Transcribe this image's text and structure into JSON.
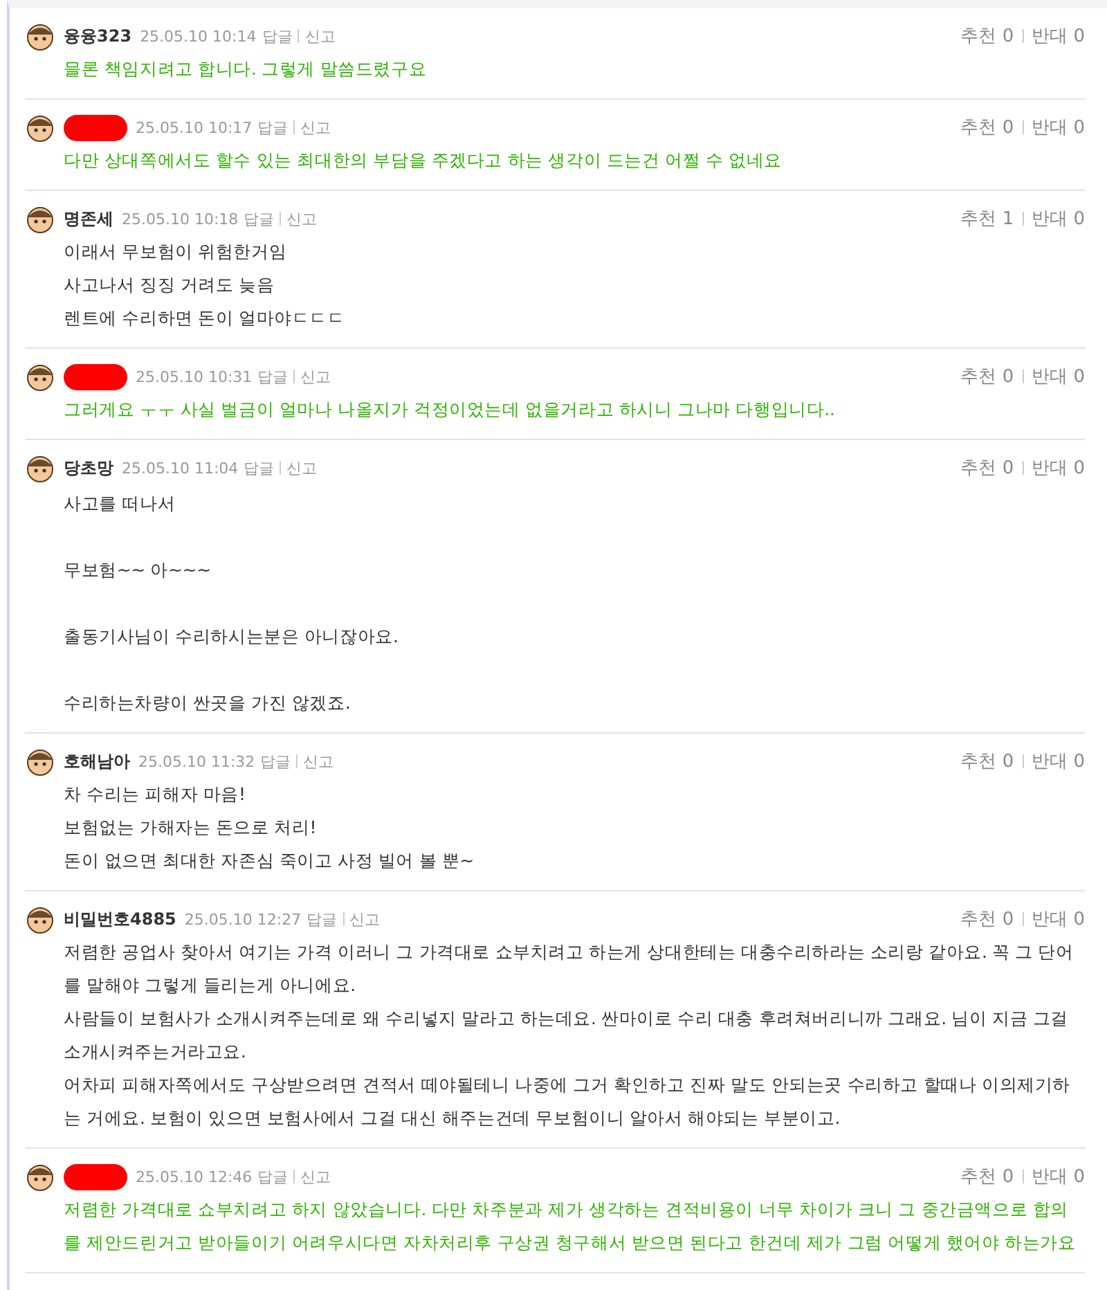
{
  "comments": [
    {
      "name_redacted": false,
      "name": "융융323",
      "time": "25.05.10 10:14",
      "reply": "답글",
      "report": "신고",
      "up_label": "추천",
      "up": "0",
      "down_label": "반대",
      "down": "0",
      "highlighted": true,
      "spaced": false,
      "lines": [
        "믈론 책임지려고 합니다. 그렇게 말씀드렸구요"
      ]
    },
    {
      "name_redacted": true,
      "time": "25.05.10 10:17",
      "reply": "답글",
      "report": "신고",
      "up_label": "추천",
      "up": "0",
      "down_label": "반대",
      "down": "0",
      "highlighted": true,
      "spaced": false,
      "lines": [
        "다만 상대쪽에서도 할수 있는 최대한의 부담을 주겠다고 하는 생각이 드는건 어쩔 수 없네요"
      ]
    },
    {
      "name_redacted": false,
      "name": "명존세",
      "time": "25.05.10 10:18",
      "reply": "답글",
      "report": "신고",
      "up_label": "추천",
      "up": "1",
      "down_label": "반대",
      "down": "0",
      "highlighted": false,
      "spaced": false,
      "lines": [
        "이래서 무보험이 위험한거임",
        "사고나서 징징 거려도 늦음",
        "렌트에 수리하면 돈이 얼마야ㄷㄷㄷ"
      ]
    },
    {
      "name_redacted": true,
      "time": "25.05.10 10:31",
      "reply": "답글",
      "report": "신고",
      "up_label": "추천",
      "up": "0",
      "down_label": "반대",
      "down": "0",
      "highlighted": true,
      "spaced": false,
      "lines": [
        "그러게요 ㅜㅜ 사실 벌금이 얼마나 나올지가 걱정이었는데 없을거라고 하시니 그나마 다행입니다.."
      ]
    },
    {
      "name_redacted": false,
      "name": "당초망",
      "time": "25.05.10 11:04",
      "reply": "답글",
      "report": "신고",
      "up_label": "추천",
      "up": "0",
      "down_label": "반대",
      "down": "0",
      "highlighted": false,
      "spaced": true,
      "lines": [
        "사고를 떠나서",
        "무보험~~ 아~~~",
        "출동기사님이 수리하시는분은 아니잖아요.",
        "수리하는차량이 싼곳을 가진 않겠죠."
      ]
    },
    {
      "name_redacted": false,
      "name": "호해남아",
      "time": "25.05.10 11:32",
      "reply": "답글",
      "report": "신고",
      "up_label": "추천",
      "up": "0",
      "down_label": "반대",
      "down": "0",
      "highlighted": false,
      "spaced": false,
      "lines": [
        "차 수리는 피해자 마음!",
        "보험없는 가해자는 돈으로 처리!",
        "돈이 없으면 최대한 자존심 죽이고 사정 빌어 볼 뿐~"
      ]
    },
    {
      "name_redacted": false,
      "name": "비밀번호4885",
      "time": "25.05.10 12:27",
      "reply": "답글",
      "report": "신고",
      "up_label": "추천",
      "up": "0",
      "down_label": "반대",
      "down": "0",
      "highlighted": false,
      "spaced": false,
      "lines": [
        "저렴한 공업사 찾아서 여기는 가격 이러니 그 가격대로 쇼부치려고 하는게 상대한테는 대충수리하라는 소리랑 같아요. 꼭 그 단어를 말해야 그렇게 들리는게 아니에요.",
        "사람들이 보험사가 소개시켜주는데로 왜 수리넣지 말라고 하는데요. 싼마이로 수리 대충 후려쳐버리니까 그래요. 님이 지금 그걸 소개시켜주는거라고요.",
        "어차피 피해자쪽에서도 구상받으려면 견적서 떼야될테니 나중에 그거 확인하고 진짜 말도 안되는곳 수리하고 할때나 이의제기하는 거에요. 보험이 있으면 보험사에서 그걸 대신 해주는건데 무보험이니 알아서 해야되는 부분이고."
      ]
    },
    {
      "name_redacted": true,
      "time": "25.05.10 12:46",
      "reply": "답글",
      "report": "신고",
      "up_label": "추천",
      "up": "0",
      "down_label": "반대",
      "down": "0",
      "highlighted": true,
      "spaced": false,
      "lines": [
        "저렴한 가격대로 쇼부치려고 하지 않았습니다. 다만 차주분과 제가 생각하는 견적비용이 너무 차이가 크니 그 중간금액으로 합의를 제안드린거고 받아들이기 어려우시다면 자차처리후 구상권 청구해서 받으면 된다고 한건데 제가 그럼 어떻게 했어야 하는가요"
      ]
    }
  ]
}
